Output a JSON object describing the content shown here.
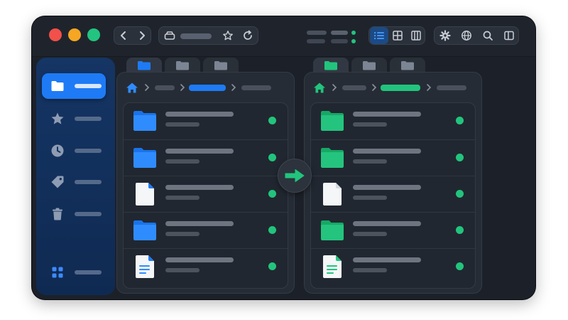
{
  "colors": {
    "accent_blue": "#1e7bf5",
    "accent_green": "#22c47d",
    "window_bg": "#1c2129",
    "sidebar_bg": "#153564"
  },
  "toolbar": {
    "window_controls": [
      "close",
      "minimize",
      "zoom"
    ],
    "nav_icons": [
      "chevron-left-icon",
      "chevron-right-icon"
    ],
    "address_icons": [
      "drive-icon",
      "star-icon",
      "refresh-icon"
    ],
    "sync_status": "connected",
    "view_modes": [
      "list-view-icon",
      "grid-view-icon",
      "columns-view-icon"
    ],
    "active_view": "list-view-icon",
    "tool_icons": [
      "gear-icon",
      "globe-icon",
      "search-icon",
      "sidebar-toggle-icon"
    ]
  },
  "sidebar": {
    "items": [
      {
        "icon": "folder-icon",
        "active": true
      },
      {
        "icon": "star-icon",
        "active": false
      },
      {
        "icon": "clock-icon",
        "active": false
      },
      {
        "icon": "tag-icon",
        "active": false
      },
      {
        "icon": "trash-icon",
        "active": false
      },
      {
        "icon": "apps-grid-icon",
        "active": false
      }
    ]
  },
  "left_pane": {
    "accent": "blue",
    "tabs": 3,
    "active_tab": 0,
    "files": [
      {
        "icon": "folder-icon",
        "status": "synced"
      },
      {
        "icon": "folder-icon",
        "status": "synced"
      },
      {
        "icon": "document-icon",
        "status": "synced"
      },
      {
        "icon": "folder-icon",
        "status": "synced"
      },
      {
        "icon": "text-document-icon",
        "status": "synced"
      }
    ]
  },
  "right_pane": {
    "accent": "green",
    "tabs": 3,
    "active_tab": 0,
    "files": [
      {
        "icon": "folder-icon",
        "status": "synced"
      },
      {
        "icon": "folder-icon",
        "status": "synced"
      },
      {
        "icon": "document-icon",
        "status": "synced"
      },
      {
        "icon": "folder-icon",
        "status": "synced"
      },
      {
        "icon": "spreadsheet-document-icon",
        "status": "synced"
      }
    ]
  },
  "transfer_button": {
    "icon": "arrow-right-icon"
  }
}
